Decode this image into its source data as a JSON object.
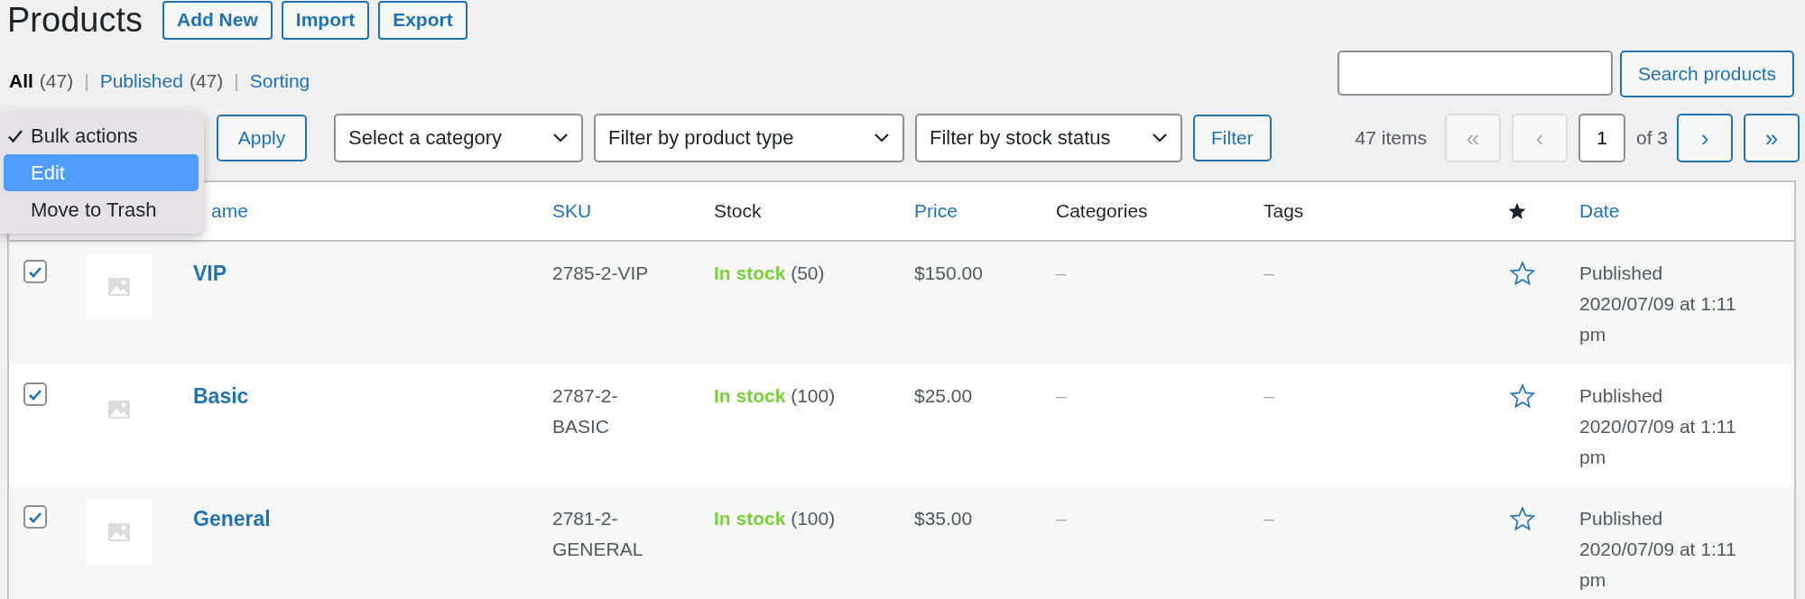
{
  "page_title": "Products",
  "header_buttons": [
    "Add New",
    "Import",
    "Export"
  ],
  "views": [
    {
      "label": "All",
      "count": "(47)",
      "selected": true,
      "separator": "|"
    },
    {
      "label": "Published",
      "count": "(47)",
      "selected": false,
      "separator": "|"
    },
    {
      "label": "Sorting",
      "selected": false
    }
  ],
  "search": {
    "button": "Search products"
  },
  "bulk_menu": [
    {
      "label": "Bulk actions",
      "checked": true,
      "selected": false
    },
    {
      "label": "Edit",
      "checked": false,
      "selected": true
    },
    {
      "label": "Move to Trash",
      "checked": false,
      "selected": false
    }
  ],
  "apply_button": "Apply",
  "filters": [
    {
      "label": "Select a category"
    },
    {
      "label": "Filter by product type"
    },
    {
      "label": "Filter by stock status"
    }
  ],
  "filter_button": "Filter",
  "pagination": {
    "count": "47 items",
    "first": {
      "label": "«",
      "disabled": true
    },
    "prev": {
      "label": "‹",
      "disabled": true
    },
    "page": "1",
    "of": "of 3",
    "next": {
      "label": "›",
      "disabled": false
    },
    "last": {
      "label": "»",
      "disabled": false
    }
  },
  "table": {
    "columns": [
      {
        "kind": "name",
        "label": "ame",
        "sortable": true
      },
      {
        "kind": "text",
        "label": "SKU",
        "sortable": true
      },
      {
        "kind": "text",
        "label": "Stock",
        "sortable": false
      },
      {
        "kind": "text",
        "label": "Price",
        "sortable": true
      },
      {
        "kind": "text",
        "label": "Categories",
        "sortable": false
      },
      {
        "kind": "text",
        "label": "Tags",
        "sortable": false
      },
      {
        "kind": "featured"
      },
      {
        "kind": "text",
        "label": "Date",
        "sortable": true
      }
    ],
    "rows": [
      {
        "checked": true,
        "name": "VIP",
        "sku": "2785-2-VIP",
        "stock_status": "In stock",
        "in_stock": true,
        "stock_count": "(50)",
        "price": "$150.00",
        "categories": "–",
        "tags": "–",
        "featured": false,
        "status": "Published",
        "date": "2020/07/09 at 1:11 pm"
      },
      {
        "checked": true,
        "name": "Basic",
        "sku": "2787-2-BASIC",
        "stock_status": "In stock",
        "in_stock": true,
        "stock_count": "(100)",
        "price": "$25.00",
        "categories": "–",
        "tags": "–",
        "featured": false,
        "status": "Published",
        "date": "2020/07/09 at 1:11 pm"
      },
      {
        "checked": true,
        "name": "General",
        "sku": "2781-2-GENERAL",
        "stock_status": "In stock",
        "in_stock": true,
        "stock_count": "(100)",
        "price": "$35.00",
        "categories": "–",
        "tags": "–",
        "featured": false,
        "status": "Published",
        "date": "2020/07/09 at 1:11 pm"
      }
    ]
  }
}
